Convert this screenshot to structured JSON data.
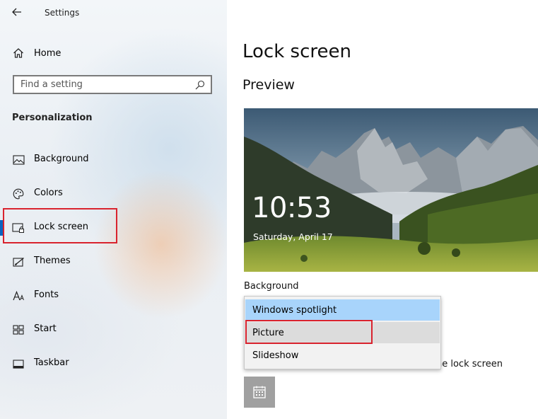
{
  "window": {
    "title": "Settings"
  },
  "sidebar": {
    "home_label": "Home",
    "search": {
      "placeholder": "Find a setting"
    },
    "section_title": "Personalization",
    "items": [
      {
        "label": "Background",
        "icon": "picture-icon"
      },
      {
        "label": "Colors",
        "icon": "palette-icon"
      },
      {
        "label": "Lock screen",
        "icon": "lock-screen-icon",
        "selected": true
      },
      {
        "label": "Themes",
        "icon": "themes-icon"
      },
      {
        "label": "Fonts",
        "icon": "fonts-icon"
      },
      {
        "label": "Start",
        "icon": "start-grid-icon"
      },
      {
        "label": "Taskbar",
        "icon": "taskbar-icon"
      }
    ]
  },
  "main": {
    "title": "Lock screen",
    "preview_heading": "Preview",
    "preview": {
      "time": "10:53",
      "date": "Saturday, April 17"
    },
    "background_label": "Background",
    "dropdown": {
      "options": [
        "Windows spotlight",
        "Picture",
        "Slideshow"
      ],
      "selected": "Windows spotlight",
      "highlighted": "Picture"
    },
    "partial_text": "he lock screen"
  },
  "colors": {
    "accent": "#0b64c0",
    "highlight_red": "#d9232e",
    "selected_option": "#a8d4fb"
  }
}
